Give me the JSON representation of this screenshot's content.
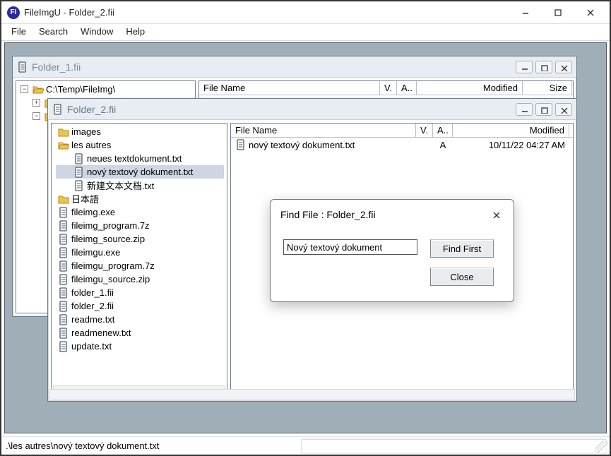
{
  "app": {
    "icon_text": "FI",
    "title": "FileImgU - Folder_2.fii"
  },
  "menus": [
    "File",
    "Search",
    "Window",
    "Help"
  ],
  "windows": {
    "back": {
      "title": "Folder_1.fii",
      "rootpath": "C:\\Temp\\FileImg\\",
      "columns": {
        "fn": "File Name",
        "v": "V.",
        "a": "A..",
        "mod": "Modified",
        "sz": "Size"
      }
    },
    "front": {
      "title": "Folder_2.fii",
      "columns": {
        "fn": "File Name",
        "v": "V.",
        "a": "A..",
        "mod": "Modified"
      },
      "tree": [
        {
          "type": "folder",
          "label": "images"
        },
        {
          "type": "folder-open",
          "label": "les autres"
        },
        {
          "type": "file",
          "label": "neues textdokument.txt",
          "indent": 1
        },
        {
          "type": "file",
          "label": "nový textový dokument.txt",
          "indent": 1,
          "selected": true
        },
        {
          "type": "file",
          "label": "新建文本文档.txt",
          "indent": 1
        },
        {
          "type": "folder",
          "label": "日本語"
        },
        {
          "type": "file",
          "label": "fileimg.exe"
        },
        {
          "type": "file",
          "label": "fileimg_program.7z"
        },
        {
          "type": "file",
          "label": "fileimg_source.zip"
        },
        {
          "type": "file",
          "label": "fileimgu.exe"
        },
        {
          "type": "file",
          "label": "fileimgu_program.7z"
        },
        {
          "type": "file",
          "label": "fileimgu_source.zip"
        },
        {
          "type": "file",
          "label": "folder_1.fii"
        },
        {
          "type": "file",
          "label": "folder_2.fii"
        },
        {
          "type": "file",
          "label": "readme.txt"
        },
        {
          "type": "file",
          "label": "readmenew.txt"
        },
        {
          "type": "file",
          "label": "update.txt"
        }
      ],
      "list": [
        {
          "fn": "nový textový dokument.txt",
          "v": "",
          "a": "A",
          "mod": "10/11/22 04:27 AM"
        }
      ]
    }
  },
  "find": {
    "title": "Find File : Folder_2.fii",
    "value": "Nový textový dokument",
    "btn_find": "Find First",
    "btn_close": "Close"
  },
  "status": {
    "path": ".\\les autres\\nový textový dokument.txt"
  },
  "togglers": {
    "minus": "−",
    "plus": "+"
  }
}
